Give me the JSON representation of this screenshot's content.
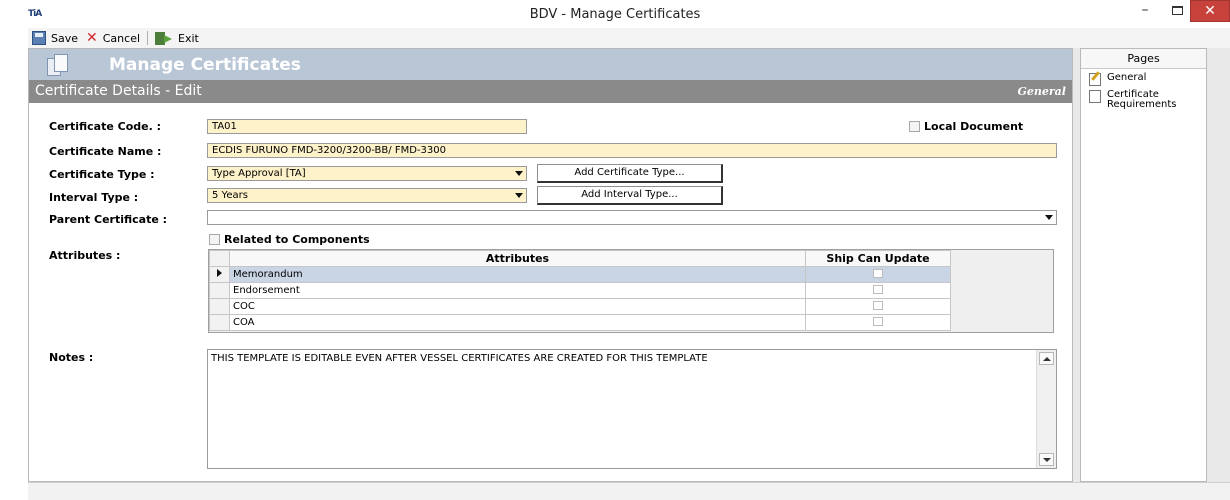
{
  "window": {
    "app_icon_text": "TiA",
    "title": "BDV - Manage Certificates",
    "minimize": "–",
    "close": "✕"
  },
  "toolbar": {
    "save_label": "Save",
    "cancel_label": "Cancel",
    "exit_label": "Exit"
  },
  "banner": {
    "title": "Manage Certificates"
  },
  "subheader": {
    "title": "Certificate Details - Edit",
    "right": "General"
  },
  "form": {
    "certificate_code_label": "Certificate Code. :",
    "certificate_code_value": "TA01",
    "local_document_label": "Local Document",
    "certificate_name_label": "Certificate Name :",
    "certificate_name_value": "ECDIS FURUNO FMD-3200/3200-BB/ FMD-3300",
    "certificate_type_label": "Certificate Type :",
    "certificate_type_value": "Type Approval [TA]",
    "add_certificate_type_button": "Add Certificate Type...",
    "interval_type_label": "Interval Type :",
    "interval_type_value": "5 Years",
    "add_interval_type_button": "Add Interval Type...",
    "parent_certificate_label": "Parent Certificate :",
    "parent_certificate_value": "",
    "related_to_components_label": "Related to Components",
    "attributes_label": "Attributes :",
    "notes_label": "Notes :",
    "notes_value": "THIS TEMPLATE IS EDITABLE EVEN AFTER VESSEL CERTIFICATES ARE CREATED FOR THIS TEMPLATE"
  },
  "attributes_grid": {
    "columns": [
      "Attributes",
      "Ship Can Update"
    ],
    "rows": [
      {
        "name": "Memorandum",
        "ship_can_update": false,
        "selected": true
      },
      {
        "name": "Endorsement",
        "ship_can_update": false,
        "selected": false
      },
      {
        "name": "COC",
        "ship_can_update": false,
        "selected": false
      },
      {
        "name": "COA",
        "ship_can_update": false,
        "selected": false
      }
    ]
  },
  "pages_panel": {
    "header": "Pages",
    "items": [
      "General",
      "Certificate Requirements"
    ]
  }
}
